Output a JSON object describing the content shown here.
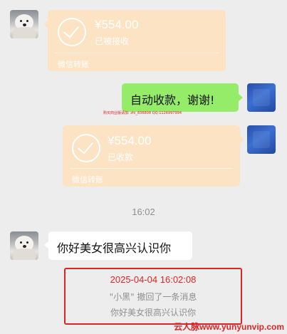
{
  "messages": {
    "transfer_received": {
      "amount": "¥554.00",
      "status": "已被接收",
      "footer": "微信转账"
    },
    "auto_reply": {
      "text": "自动收款，谢谢!"
    },
    "tiny_watermark": "购买商业版请加: zhi_836808  QQ:1126997994",
    "transfer_collected": {
      "amount": "¥554.00",
      "status": "已收款",
      "footer": "微信转账"
    },
    "timestamp": "16:02",
    "greeting": {
      "text": "你好美女很高兴认识你"
    },
    "recall_notice": {
      "datetime": "2025-04-04 16:02:08",
      "notice": "\"小黑\" 撤回了一条消息",
      "recalled_text": "你好美女很高兴认识你"
    },
    "brand_watermark": "云人脉www.yunyunvip.com",
    "colors": {
      "chat_background": "#ededed",
      "transfer_card": "#fbe3c4",
      "green_bubble": "#95ec69",
      "accent_red": "#e02424"
    }
  }
}
